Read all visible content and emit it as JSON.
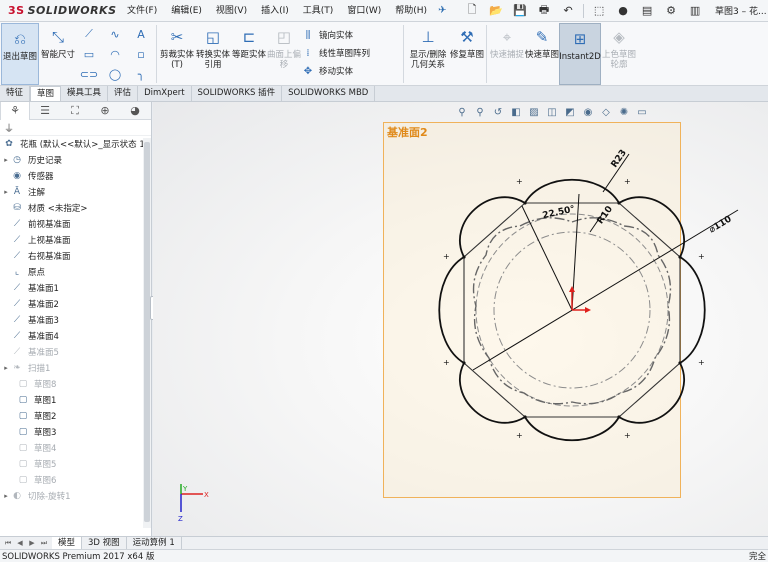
{
  "app": {
    "logo_ds": "3S",
    "logo_text": "SOLIDWORKS",
    "title": "草图3 – 花..."
  },
  "menu": [
    "文件(F)",
    "编辑(E)",
    "视图(V)",
    "插入(I)",
    "工具(T)",
    "窗口(W)",
    "帮助(H)"
  ],
  "ribbon": {
    "exit_sketch": "退出草图",
    "smart_dim": "智能尺寸",
    "trim": "剪裁实体(T)",
    "convert": "转换实体引用",
    "offset": "等距实体",
    "surface_offset": "曲面上偏移",
    "mirror": "镜向实体",
    "linear_array": "线性草图阵列",
    "move": "移动实体",
    "display_delete": "显示/删除几何关系",
    "repair": "修复草图",
    "quick_snap": "快速捕捉",
    "quick_sketch": "快速草图",
    "instant2d": "Instant2D",
    "shaded": "上色草图轮廓"
  },
  "tabs": [
    "特征",
    "草图",
    "模具工具",
    "评估",
    "DimXpert",
    "SOLIDWORKS 插件",
    "SOLIDWORKS MBD"
  ],
  "tree": {
    "root": "花瓶 (默认<<默认>_显示状态 1",
    "items": [
      {
        "label": "历史记录",
        "icon": "history-icon"
      },
      {
        "label": "传感器",
        "icon": "sensor-icon"
      },
      {
        "label": "注解",
        "icon": "annotation-icon"
      },
      {
        "label": "材质 <未指定>",
        "icon": "material-icon"
      },
      {
        "label": "前视基准面",
        "icon": "plane-icon"
      },
      {
        "label": "上视基准面",
        "icon": "plane-icon"
      },
      {
        "label": "右视基准面",
        "icon": "plane-icon"
      },
      {
        "label": "原点",
        "icon": "origin-icon"
      },
      {
        "label": "基准面1",
        "icon": "plane-icon"
      },
      {
        "label": "基准面2",
        "icon": "plane-icon"
      },
      {
        "label": "基准面3",
        "icon": "plane-icon"
      },
      {
        "label": "基准面4",
        "icon": "plane-icon"
      },
      {
        "label": "基准面5",
        "icon": "plane-icon"
      }
    ],
    "sweep": "扫描1",
    "sweep_children": [
      "草图8",
      "草图1",
      "草图2",
      "草图3",
      "草图4",
      "草图5",
      "草图6"
    ],
    "last": "切除-旋转1"
  },
  "canvas": {
    "plane_label": "基准面2",
    "dimensions": {
      "r23": "R23",
      "angle": "22.50°",
      "r10": "R10",
      "dia": "⌀110"
    }
  },
  "bottom_tabs": [
    "模型",
    "3D 视图",
    "运动算例 1"
  ],
  "status": {
    "left": "SOLIDWORKS Premium 2017 x64 版",
    "right": "完全"
  },
  "axes": {
    "x": "X",
    "y": "Y",
    "z": "Z"
  }
}
